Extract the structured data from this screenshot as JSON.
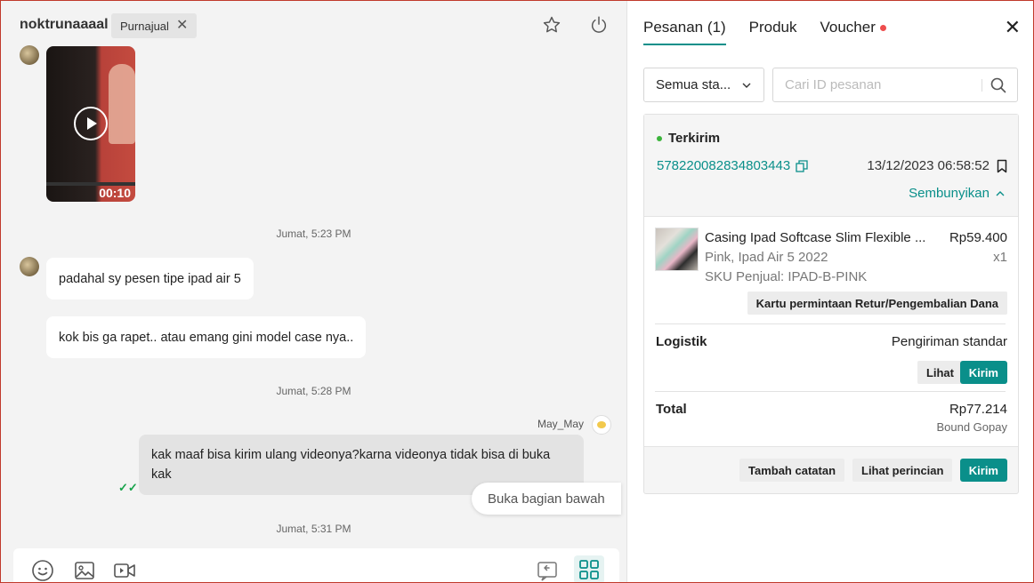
{
  "chat": {
    "username": "noktrunaaaal",
    "tag_label": "Purnajual",
    "video_duration": "00:10",
    "messages": [
      {
        "timestamp": "Jumat, 5:23 PM"
      },
      {
        "text": "padahal sy pesen tipe ipad air 5"
      },
      {
        "text": "kok bis ga rapet.. atau emang gini model case nya.."
      },
      {
        "timestamp": "Jumat, 5:28 PM"
      },
      {
        "sender": "May_May",
        "text": "kak maaf bisa kirim ulang videonya?karna videonya tidak bisa di buka kak"
      },
      {
        "timestamp": "Jumat, 5:31 PM"
      }
    ],
    "read_indicator": "✓✓",
    "scroll_button": "Buka bagian bawah"
  },
  "panel": {
    "tabs": [
      {
        "label": "Pesanan (1)",
        "active": true
      },
      {
        "label": "Produk",
        "active": false
      },
      {
        "label": "Voucher",
        "active": false,
        "has_dot": true
      }
    ],
    "filter_select": "Semua sta...",
    "search_placeholder": "Cari ID pesanan",
    "order": {
      "status": "Terkirim",
      "id": "578220082834803443",
      "datetime": "13/12/2023 06:58:52",
      "toggle_label": "Sembunyikan",
      "product": {
        "name": "Casing Ipad Softcase Slim Flexible ...",
        "price": "Rp59.400",
        "variant": "Pink, Ipad Air 5 2022",
        "qty": "x1",
        "sku": "SKU Penjual: IPAD-B-PINK"
      },
      "return_button": "Kartu permintaan Retur/Pengembalian Dana",
      "logistics_label": "Logistik",
      "logistics_value": "Pengiriman standar",
      "view_button": "Lihat",
      "send_button": "Kirim",
      "total_label": "Total",
      "total_value": "Rp77.214",
      "payment_method": "Bound Gopay",
      "footer_buttons": {
        "add_note": "Tambah catatan",
        "view_details": "Lihat perincian",
        "send": "Kirim"
      }
    }
  },
  "colors": {
    "accent": "#0a8f8a",
    "status_green": "#3cb43c",
    "notification_red": "#ee4d4d"
  }
}
